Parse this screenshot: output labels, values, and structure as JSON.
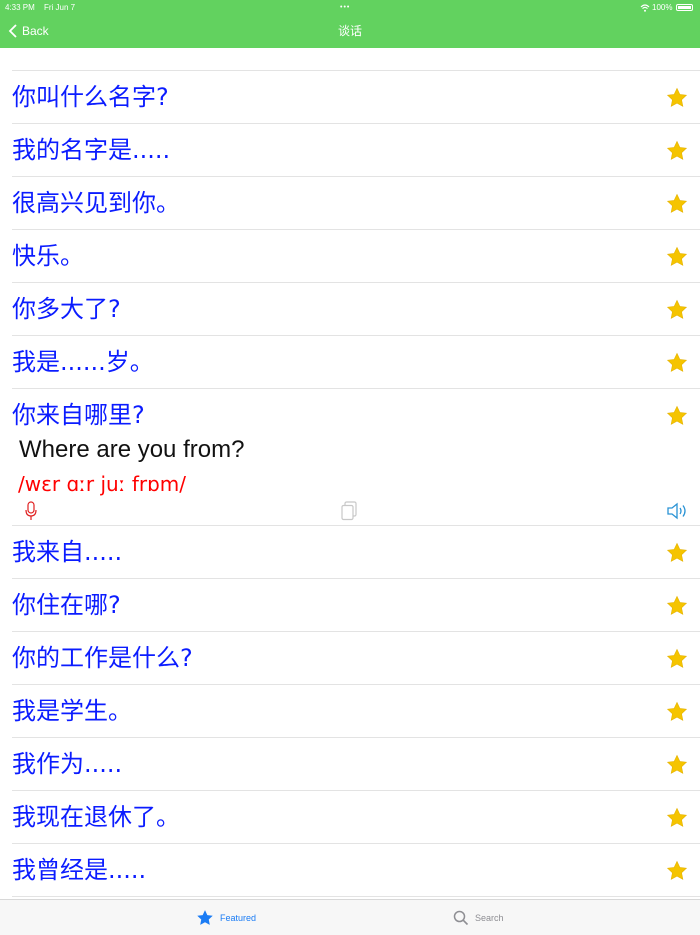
{
  "status_bar": {
    "time": "4:33 PM",
    "date": "Fri Jun 7",
    "battery": "100%"
  },
  "nav": {
    "back_label": "Back",
    "title": "谈话"
  },
  "colors": {
    "header": "#62d25f",
    "chinese_text": "#0b1cff",
    "ipa_text": "#ff0000",
    "star": "#f5c400",
    "tab_active": "#1a7cf5"
  },
  "phrases": [
    {
      "zh": "你叫什么名字?"
    },
    {
      "zh": "我的名字是....."
    },
    {
      "zh": "很高兴见到你。"
    },
    {
      "zh": "快乐。"
    },
    {
      "zh": "你多大了?"
    },
    {
      "zh": "我是......岁。"
    },
    {
      "zh": "你来自哪里?",
      "en": "Where are you from?",
      "ipa": "/wɛr ɑːr juː frɒm/"
    },
    {
      "zh": "我来自....."
    },
    {
      "zh": "你住在哪?"
    },
    {
      "zh": "你的工作是什么?"
    },
    {
      "zh": "我是学生。"
    },
    {
      "zh": "我作为....."
    },
    {
      "zh": "我现在退休了。"
    },
    {
      "zh": "我曾经是....."
    }
  ],
  "tabs": {
    "featured_label": "Featured",
    "search_label": "Search"
  },
  "icons": [
    "back-chevron-icon",
    "star-icon",
    "mic-icon",
    "copy-icon",
    "speaker-icon",
    "search-icon"
  ]
}
